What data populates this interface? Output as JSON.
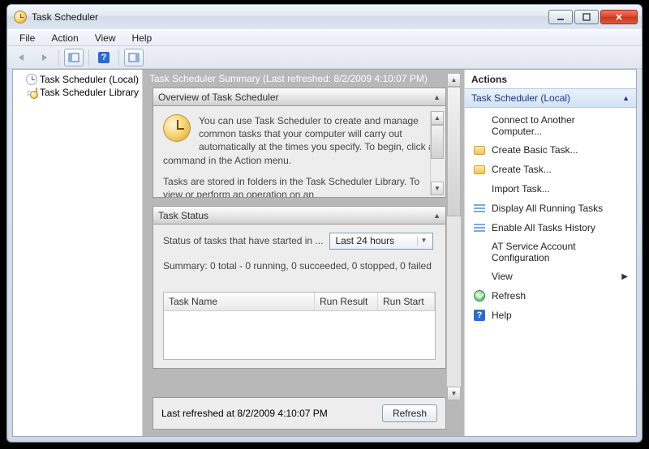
{
  "window": {
    "title": "Task Scheduler"
  },
  "menubar": [
    "File",
    "Action",
    "View",
    "Help"
  ],
  "tree": {
    "root": "Task Scheduler (Local)",
    "child": "Task Scheduler Library"
  },
  "summary": {
    "heading": "Task Scheduler Summary (Last refreshed: 8/2/2009 4:10:07 PM)"
  },
  "overview": {
    "title": "Overview of Task Scheduler",
    "p1": "You can use Task Scheduler to create and manage common tasks that your computer will carry out automatically at the times you specify. To begin, click a command in the Action menu.",
    "p2": "Tasks are stored in folders in the Task Scheduler Library. To view or perform an operation on an"
  },
  "status": {
    "title": "Task Status",
    "label": "Status of tasks that have started in ...",
    "range": "Last 24 hours",
    "summary": "Summary: 0 total - 0 running, 0 succeeded, 0 stopped, 0 failed",
    "cols": {
      "name": "Task Name",
      "result": "Run Result",
      "start": "Run Start"
    }
  },
  "footer": {
    "text": "Last refreshed at 8/2/2009 4:10:07 PM",
    "refresh": "Refresh"
  },
  "actions": {
    "title": "Actions",
    "scope": "Task Scheduler (Local)",
    "items": {
      "connect": "Connect to Another Computer...",
      "basic": "Create Basic Task...",
      "create": "Create Task...",
      "import": "Import Task...",
      "running": "Display All Running Tasks",
      "history": "Enable All Tasks History",
      "atsvc": "AT Service Account Configuration",
      "view": "View",
      "refresh": "Refresh",
      "help": "Help"
    }
  }
}
